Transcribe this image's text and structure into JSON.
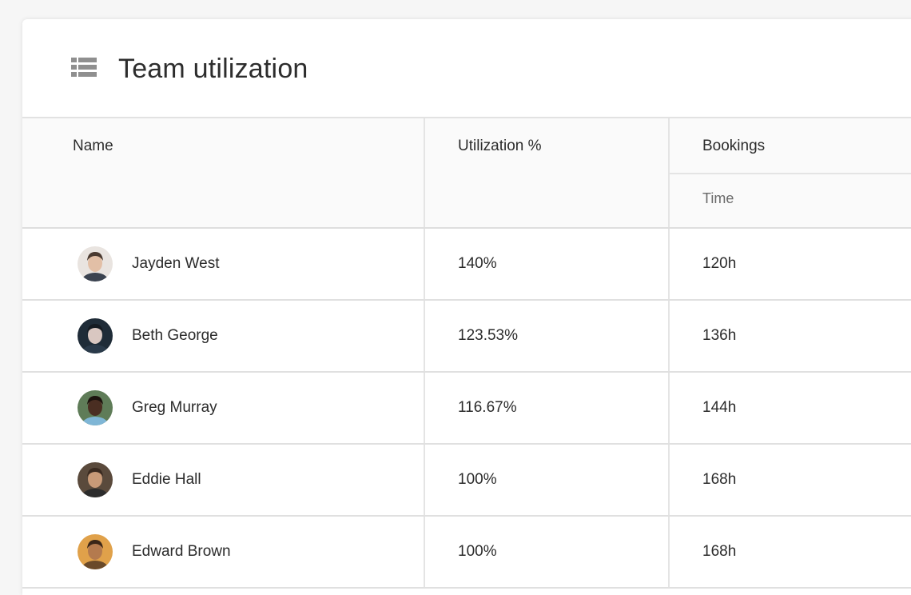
{
  "card": {
    "title": "Team utilization",
    "icon": "table-list-icon"
  },
  "table": {
    "columns": {
      "name": "Name",
      "utilization": "Utilization %",
      "bookings": "Bookings",
      "time": "Time"
    },
    "rows": [
      {
        "name": "Jayden West",
        "utilization": "140%",
        "time": "120h",
        "avatar_bg": "#e9e4e0",
        "avatar_skin": "#e2bfa6",
        "avatar_hair": "#4a3a30",
        "avatar_shirt": "#3b4350"
      },
      {
        "name": "Beth George",
        "utilization": "123.53%",
        "time": "136h",
        "avatar_bg": "#1f2c38",
        "avatar_skin": "#d9c7c1",
        "avatar_hair": "#151b22",
        "avatar_shirt": "#2a3a4a"
      },
      {
        "name": "Greg Murray",
        "utilization": "116.67%",
        "time": "144h",
        "avatar_bg": "#5f7c58",
        "avatar_skin": "#4a2e22",
        "avatar_hair": "#1c120e",
        "avatar_shirt": "#7fb6d6"
      },
      {
        "name": "Eddie Hall",
        "utilization": "100%",
        "time": "168h",
        "avatar_bg": "#5a4a3c",
        "avatar_skin": "#c89a78",
        "avatar_hair": "#3a2a20",
        "avatar_shirt": "#2c2c2c"
      },
      {
        "name": "Edward Brown",
        "utilization": "100%",
        "time": "168h",
        "avatar_bg": "#e0a14a",
        "avatar_skin": "#b47a4e",
        "avatar_hair": "#3a2618",
        "avatar_shirt": "#6a4a2a"
      }
    ]
  }
}
